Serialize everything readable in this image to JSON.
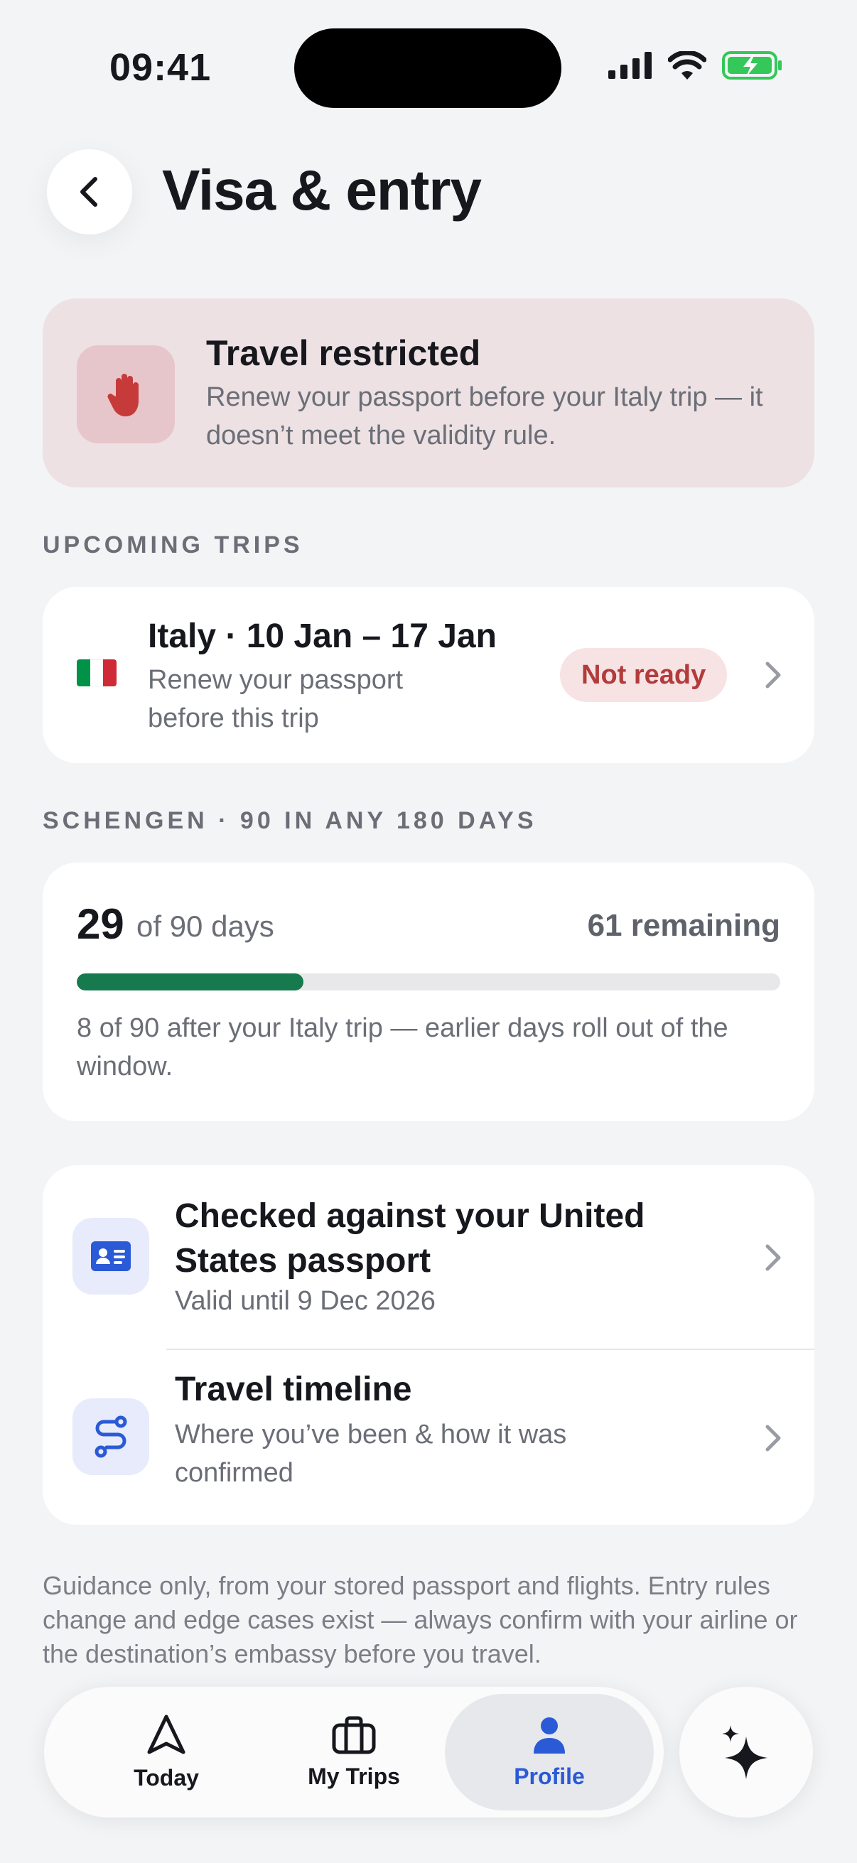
{
  "status_bar": {
    "time": "09:41"
  },
  "header": {
    "title": "Visa & entry"
  },
  "alert": {
    "title": "Travel restricted",
    "body": "Renew your passport before your Italy trip — it doesn’t meet the validity rule."
  },
  "upcoming": {
    "section_label": "UPCOMING TRIPS",
    "trip": {
      "title": "Italy · 10 Jan – 17 Jan",
      "subtitle": "Renew your passport before this trip",
      "badge": "Not ready",
      "flag_colors": [
        "#009246",
        "#ffffff",
        "#ce2b37"
      ]
    }
  },
  "schengen": {
    "section_label": "SCHENGEN · 90 IN ANY 180 DAYS",
    "used": "29",
    "of_label": "of 90 days",
    "remaining": "61 remaining",
    "progress_fraction": 0.322,
    "note": "8 of 90 after your Italy trip — earlier days roll out of the window."
  },
  "details": {
    "passport": {
      "title": "Checked against your United States passport",
      "subtitle": "Valid until 9 Dec 2026",
      "icon": "id-card-icon"
    },
    "timeline": {
      "title": "Travel timeline",
      "subtitle": "Where you’ve been & how it was confirmed",
      "icon": "route-icon"
    }
  },
  "disclaimer": "Guidance only, from your stored passport and flights. Entry rules change and edge cases exist — always confirm with your airline or the destination’s embassy before you travel.",
  "tabbar": {
    "tabs": [
      {
        "label": "Today",
        "icon": "navigation-arrow-icon"
      },
      {
        "label": "My Trips",
        "icon": "suitcase-icon"
      },
      {
        "label": "Profile",
        "icon": "person-icon",
        "active": true
      }
    ],
    "assistant_icon": "sparkles-icon"
  },
  "colors": {
    "accent_blue": "#2b5ad6",
    "progress_green": "#177a4f",
    "alert_red": "#b23b3b",
    "battery_green": "#34c759"
  }
}
